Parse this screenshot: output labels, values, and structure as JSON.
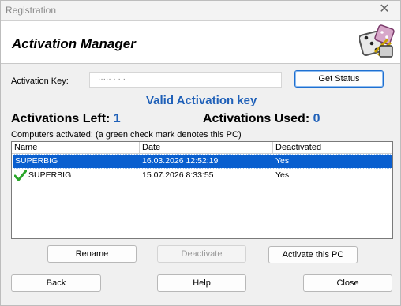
{
  "window": {
    "title": "Registration"
  },
  "header": {
    "title": "Activation Manager"
  },
  "activation_key": {
    "label": "Activation Key:",
    "value": "····· ·  · ·"
  },
  "buttons": {
    "get_status": "Get Status",
    "rename": "Rename",
    "deactivate": "Deactivate",
    "activate_pc": "Activate this PC",
    "back": "Back",
    "help": "Help",
    "close": "Close"
  },
  "status_message": "Valid Activation key",
  "counts": {
    "left_label": "Activations Left:",
    "left_value": "1",
    "used_label": "Activations Used:",
    "used_value": "0"
  },
  "list": {
    "caption": "Computers activated: (a green check mark denotes this PC)",
    "columns": [
      "Name",
      "Date",
      "Deactivated"
    ],
    "rows": [
      {
        "name": "SUPERBIG",
        "date": "16.03.2026 12:52:19",
        "deactivated": "Yes",
        "selected": true,
        "this_pc": false
      },
      {
        "name": "SUPERBIG",
        "date": "15.07.2026 8:33:55",
        "deactivated": "Yes",
        "selected": false,
        "this_pc": true
      }
    ]
  },
  "icons": {
    "close": "close-icon",
    "logo": "dice-logo-icon",
    "check": "green-check-icon"
  },
  "colors": {
    "accent": "#1f60b8",
    "selection": "#0a5fcf",
    "check": "#2aa62a"
  }
}
